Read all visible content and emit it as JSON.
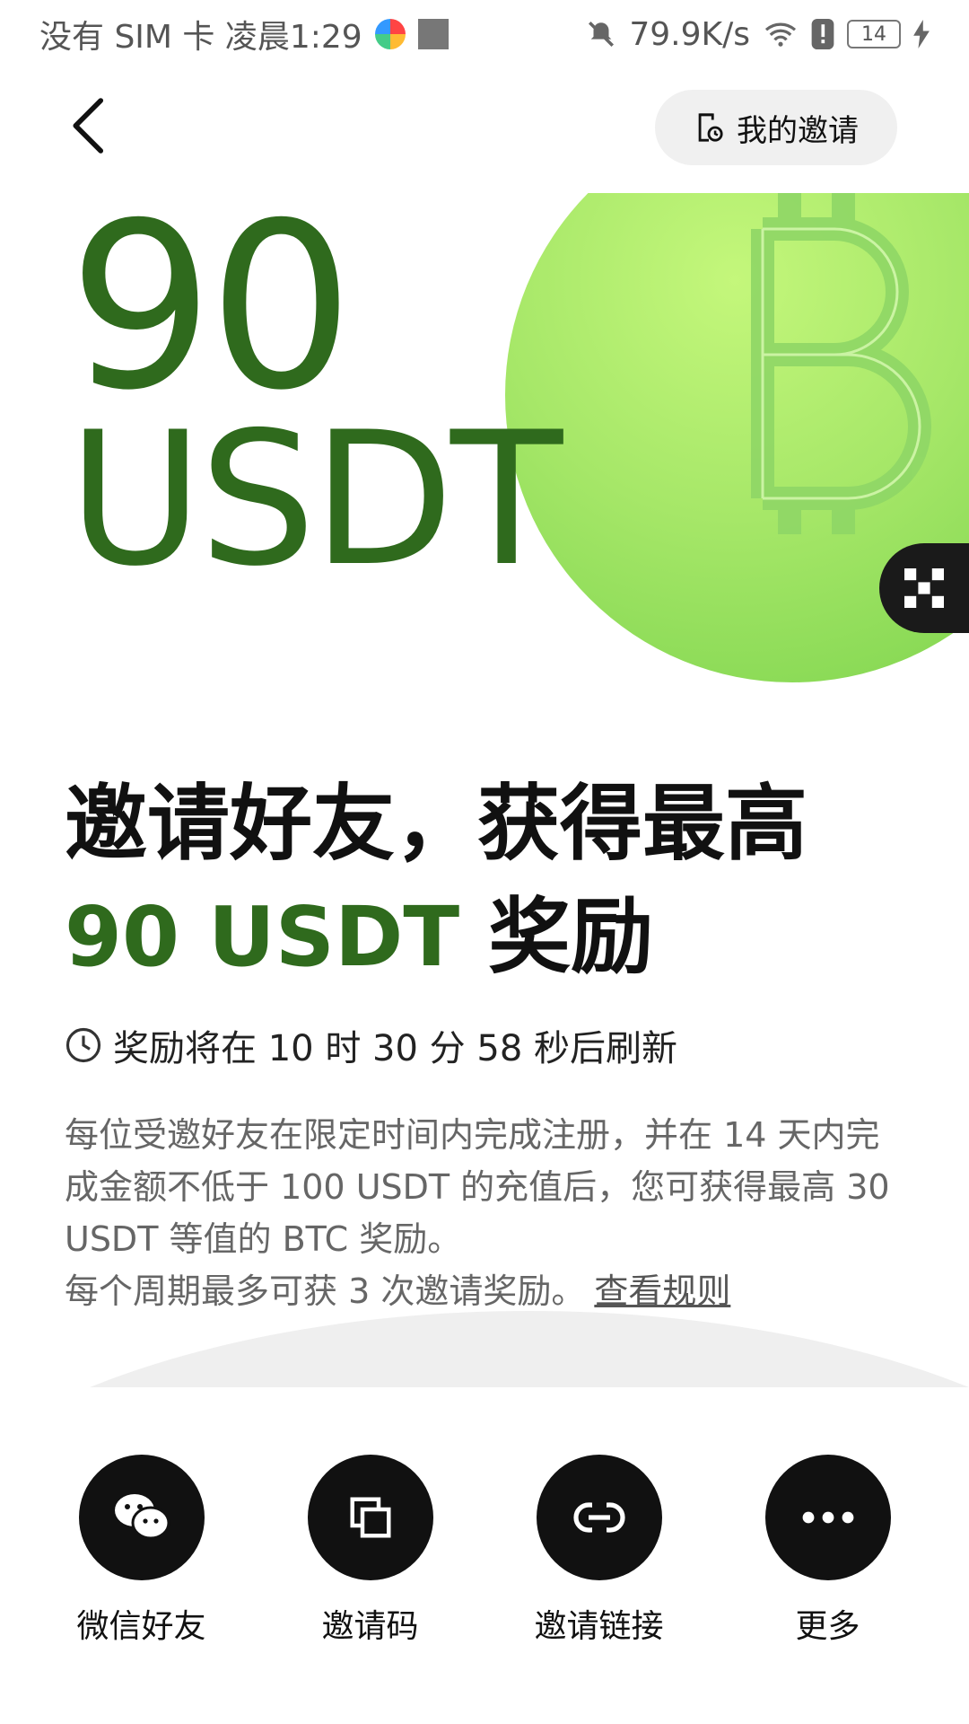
{
  "status_bar": {
    "carrier": "没有 SIM 卡 凌晨1:29",
    "net_speed": "79.9K/s",
    "battery": "14"
  },
  "header": {
    "my_invites_label": "我的邀请"
  },
  "hero": {
    "amount": "90",
    "unit": "USDT"
  },
  "headline": {
    "line1": "邀请好友，获得最高",
    "amount_text": "90 USDT",
    "suffix": " 奖励"
  },
  "countdown": {
    "text": "奖励将在 10 时 30 分 58 秒后刷新"
  },
  "description": {
    "text": "每位受邀好友在限定时间内完成注册，并在 14 天内完成金额不低于 100 USDT 的充值后，您可获得最高 30 USDT 等值的 BTC 奖励。",
    "text2": "每个周期最多可获 3 次邀请奖励。",
    "rules_link": "查看规则"
  },
  "share": [
    {
      "label": "微信好友",
      "icon": "wechat-icon"
    },
    {
      "label": "邀请码",
      "icon": "copy-icon"
    },
    {
      "label": "邀请链接",
      "icon": "link-icon"
    },
    {
      "label": "更多",
      "icon": "more-icon"
    }
  ],
  "colors": {
    "accent_green": "#2f6a1d",
    "coin_green": "#a6e768"
  }
}
